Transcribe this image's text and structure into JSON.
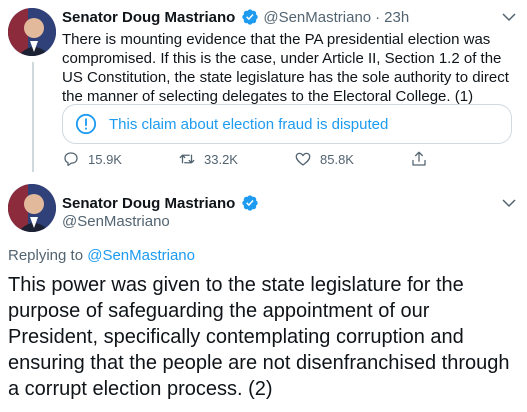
{
  "tweet1": {
    "author_name": "Senator Doug Mastriano",
    "handle": "@SenMastriano",
    "separator": "·",
    "time": "23h",
    "text": "There is mounting evidence that the PA presidential election was compromised.  If this is the case, under Article II, Section 1.2 of the US Constitution, the state legislature has the sole authority to direct the manner of selecting delegates to the Electoral College. (1)",
    "disputed_label": "This claim about election fraud is disputed",
    "replies": "15.9K",
    "retweets": "33.2K",
    "likes": "85.8K"
  },
  "tweet2": {
    "author_name": "Senator Doug Mastriano",
    "handle": "@SenMastriano",
    "replying_prefix": "Replying to",
    "replying_to": "@SenMastriano",
    "text": "This power was given to the state legislature for the purpose of safeguarding the appointment of our President, specifically contemplating corruption and ensuring that the people are not disenfranchised through a corrupt election process. (2)"
  },
  "colors": {
    "accent": "#1d9bf0",
    "muted": "#536471",
    "border": "#cfd9de"
  },
  "icons": [
    "avatar",
    "verified-badge-icon",
    "more-chevron-icon",
    "info-icon",
    "reply-icon",
    "retweet-icon",
    "like-icon",
    "share-icon"
  ]
}
